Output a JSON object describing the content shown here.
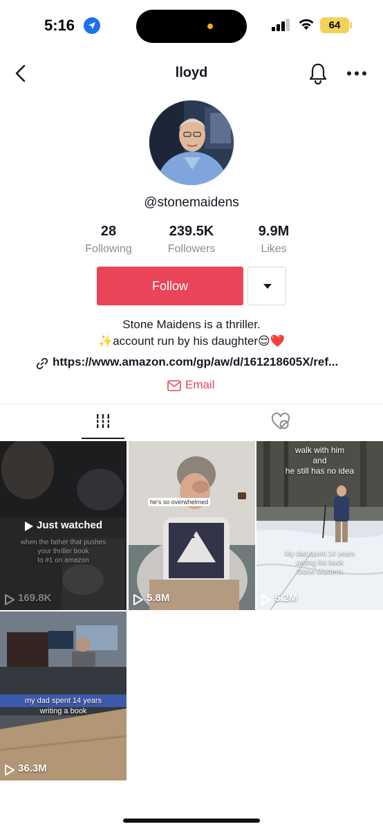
{
  "status_bar": {
    "time": "5:16",
    "battery": "64",
    "icons": [
      "location-arrow-icon",
      "signal-icon",
      "wifi-icon",
      "battery-icon"
    ],
    "battery_color": "#f2d35a"
  },
  "nav": {
    "title": "lloyd",
    "icons": [
      "chevron-left-icon",
      "bell-icon",
      "more-icon"
    ]
  },
  "profile": {
    "handle": "@stonemaidens",
    "stats": [
      {
        "value": "28",
        "label": "Following"
      },
      {
        "value": "239.5K",
        "label": "Followers"
      },
      {
        "value": "9.9M",
        "label": "Likes"
      }
    ],
    "follow_label": "Follow",
    "bio_line1": "Stone Maidens is a thriller.",
    "bio_line2": "✨account run by his daughter😌❤️",
    "link": "https://www.amazon.com/gp/aw/d/161218605X/ref...",
    "email_label": "Email",
    "accent_color": "#ea4459"
  },
  "tabs": [
    {
      "icon": "grid-icon",
      "active": true
    },
    {
      "icon": "liked-hidden-icon",
      "active": false
    }
  ],
  "videos": [
    {
      "views": "169.8K",
      "label": "Just watched",
      "overlay": [
        "when the father that pushes",
        "your thriller book",
        "to #1 on amazon"
      ]
    },
    {
      "views": "5.8M",
      "sticker": "he's so overwhelmed"
    },
    {
      "views": "5.2M",
      "overlay_top": [
        "walk with him",
        "and",
        "he still has no idea"
      ],
      "overlay_bottom": [
        "My dad spent 14 years",
        "writing his book",
        "Stone Maidens"
      ]
    },
    {
      "views": "36.3M",
      "caption": [
        "my dad spent 14 years",
        "writing a book"
      ]
    }
  ]
}
